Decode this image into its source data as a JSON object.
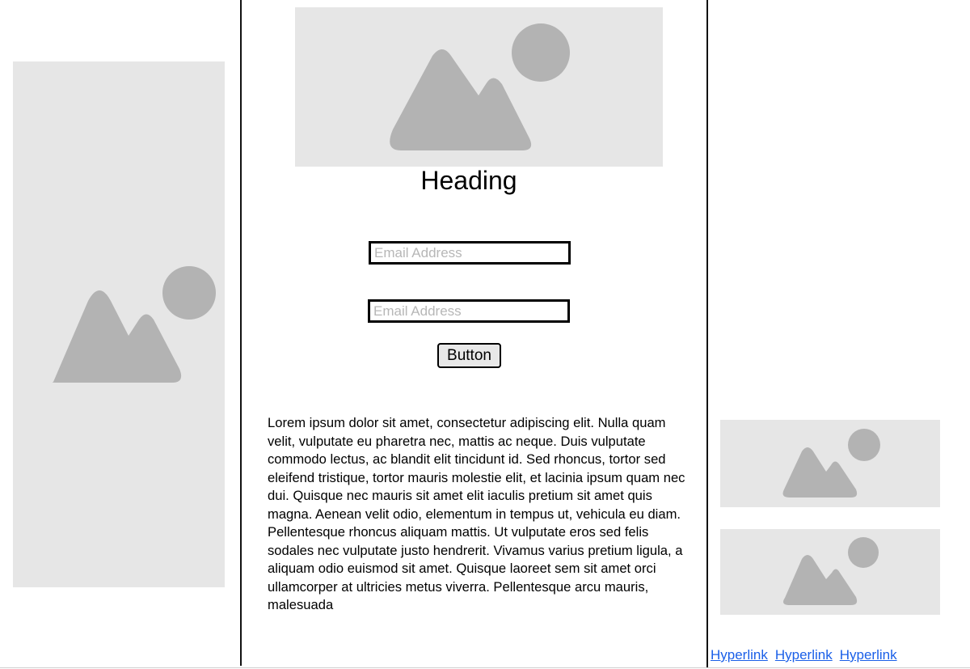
{
  "main": {
    "heading": "Heading",
    "inputs": [
      {
        "placeholder": "Email Address",
        "value": ""
      },
      {
        "placeholder": "Email Address",
        "value": ""
      }
    ],
    "button_label": "Button",
    "paragraph": "Lorem ipsum dolor sit amet, consectetur adipiscing elit. Nulla quam velit, vulputate eu pharetra nec, mattis ac neque. Duis vulputate commodo lectus, ac blandit elit tincidunt id. Sed rhoncus, tortor sed eleifend tristique, tortor mauris molestie elit, et lacinia ipsum quam nec dui. Quisque nec mauris sit amet elit iaculis pretium sit amet quis magna. Aenean velit odio, elementum in tempus ut, vehicula eu diam. Pellentesque rhoncus aliquam mattis. Ut vulputate eros sed felis sodales nec vulputate justo hendrerit. Vivamus varius pretium ligula, a aliquam odio euismod sit amet. Quisque laoreet sem sit amet orci ullamcorper at ultricies metus viverra. Pellentesque arcu mauris, malesuada"
  },
  "footer": {
    "links": [
      "Hyperlink",
      "Hyperlink",
      "Hyperlink"
    ]
  },
  "placeholders": {
    "icon": "image-placeholder-icon",
    "background_color": "#e6e6e6",
    "glyph_color": "#b3b3b3"
  },
  "colors": {
    "link": "#1a5fe8",
    "divider": "#111111"
  }
}
